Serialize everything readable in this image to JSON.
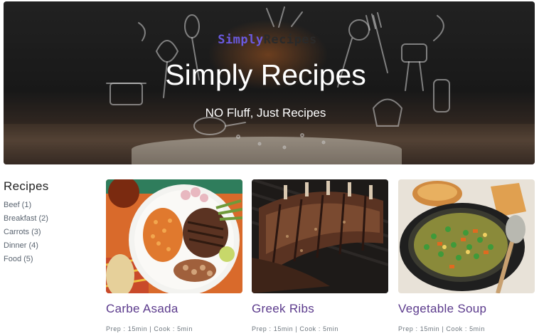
{
  "hero": {
    "brand_part1": "Simply",
    "brand_part2": "Recipes",
    "title": "Simply Recipes",
    "subtitle": "NO Fluff, Just Recipes"
  },
  "sidebar": {
    "heading": "Recipes",
    "items": [
      {
        "label": "Beef (1)"
      },
      {
        "label": "Breakfast (2)"
      },
      {
        "label": "Carrots (3)"
      },
      {
        "label": "Dinner (4)"
      },
      {
        "label": "Food (5)"
      }
    ]
  },
  "recipes": [
    {
      "title": "Carbe Asada",
      "meta": "Prep : 15min | Cook : 5min"
    },
    {
      "title": "Greek Ribs",
      "meta": "Prep : 15min | Cook : 5min"
    },
    {
      "title": "Vegetable Soup",
      "meta": "Prep : 15min | Cook : 5min"
    }
  ],
  "colors": {
    "brand_accent": "#6a5ae0",
    "recipe_title": "#5b3a8c",
    "meta_text": "#6c757d"
  }
}
